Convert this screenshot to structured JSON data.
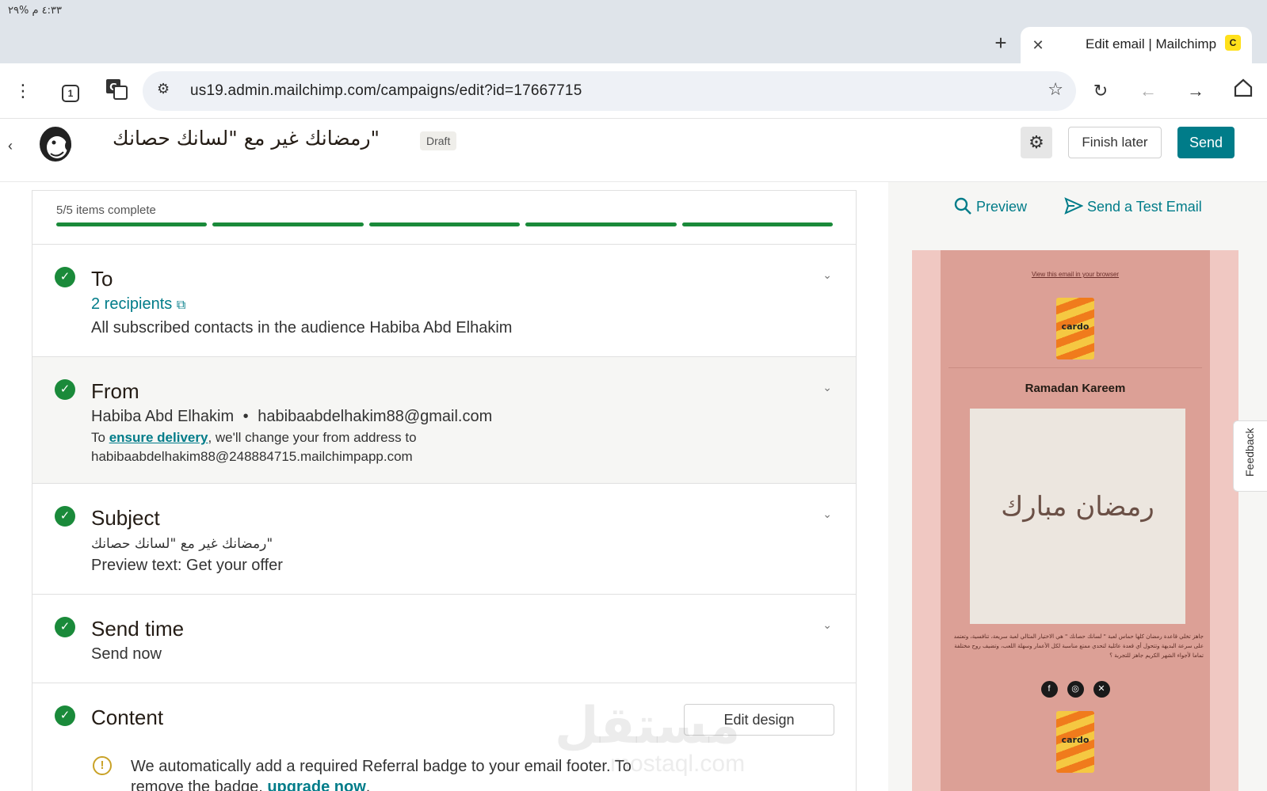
{
  "statusbar": {
    "text": "٤:٣٣ م  %٢٩"
  },
  "browser": {
    "tab_title": "Edit email | Mailchimp",
    "url": "us19.admin.mailchimp.com/campaigns/edit?id=17667715",
    "tab_count": "1"
  },
  "header": {
    "campaign_title": "\"رمضانك غير مع \"لسانك حصانك",
    "status_badge": "Draft",
    "finish_later": "Finish later",
    "send": "Send"
  },
  "progress": {
    "text": "5/5 items complete",
    "completed": 5,
    "total": 5
  },
  "sections": {
    "to": {
      "title": "To",
      "recipients": "2 recipients",
      "detail": "All subscribed contacts in the audience Habiba Abd Elhakim"
    },
    "from": {
      "title": "From",
      "name": "Habiba Abd Elhakim",
      "separator": "•",
      "email": "habibaabdelhakim88@gmail.com",
      "note_prefix": "To ",
      "note_link": "ensure delivery",
      "note_suffix": ", we'll change your from address to",
      "alt_address": "habibaabdelhakim88@248884715.mailchimpapp.com"
    },
    "subject": {
      "title": "Subject",
      "subject_text": "\"رمضانك غير مع \"لسانك حصانك",
      "preview_text": "Preview text: Get your offer"
    },
    "send_time": {
      "title": "Send time",
      "value": "Send now"
    },
    "content": {
      "title": "Content",
      "edit_design": "Edit design",
      "warning_prefix": "We automatically add a required Referral badge to your email footer. To remove the badge, ",
      "warning_link": "upgrade now",
      "warning_suffix": "."
    }
  },
  "preview_pane": {
    "preview": "Preview",
    "send_test": "Send a Test Email",
    "feedback": "Feedback",
    "email": {
      "view_in_browser": "View this email in your browser",
      "logo_text": "cardo",
      "title": "Ramadan Kareem",
      "calligraphy": "رمضان مبارك",
      "body": "جاهز تخلي قاعدة رمضان كلها حماس لعبة \" لسانك حصانك \" هي الاختيار المثالي لعبة سريعة، تنافسية، وتعتمد على سرعة البديهة وتتحول أي قعدة عائلية لتحدي ممتع مناسبة لكل الأعمار وسهلة اللعب، وتضيف روح مختلفة تماما لأجواء الشهر الكريم جاهز للتجربة ؟"
    }
  },
  "watermark": {
    "main": "مستقل",
    "sub": "mostaql.com"
  },
  "colors": {
    "accent": "#007c89",
    "success": "#1a8a3a",
    "email_bg": "#dca096"
  }
}
